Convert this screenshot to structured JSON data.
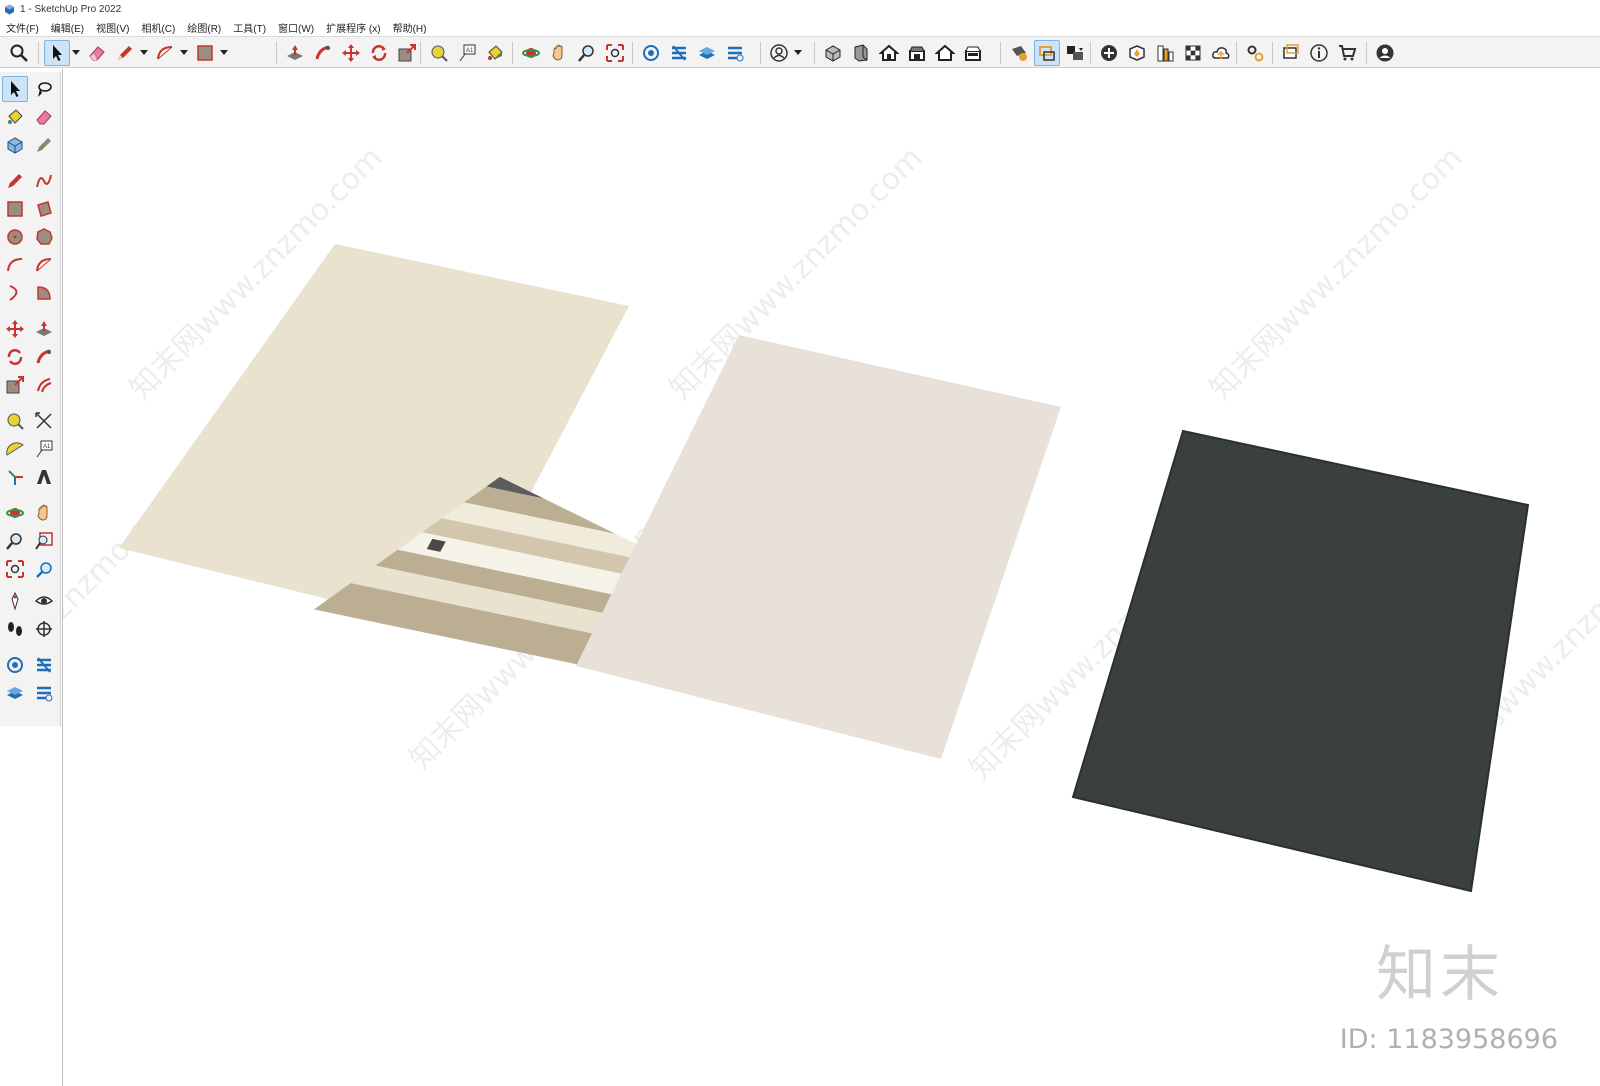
{
  "window": {
    "title": "1 - SketchUp Pro 2022"
  },
  "menu": [
    {
      "label": "文件(F)"
    },
    {
      "label": "编辑(E)"
    },
    {
      "label": "视图(V)"
    },
    {
      "label": "相机(C)"
    },
    {
      "label": "绘图(R)"
    },
    {
      "label": "工具(T)"
    },
    {
      "label": "窗口(W)"
    },
    {
      "label": "扩展程序 (x)"
    },
    {
      "label": "帮助(H)"
    }
  ],
  "top_toolbar_icons": [
    "zoom-extents-icon",
    "select-icon",
    "eraser-icon",
    "pencil-line-icon",
    "arc-icon",
    "rectangle-icon",
    "push-pull-icon",
    "follow-me-icon",
    "move-icon",
    "rotate-icon",
    "scale-icon",
    "tape-measure-icon",
    "text-label-icon",
    "paint-bucket-icon",
    "orbit-icon",
    "pan-icon",
    "zoom-icon",
    "zoom-extents-icon",
    "warehouse-icon",
    "extension-warehouse-icon",
    "layout-icon",
    "extension-manager-icon",
    "account-icon",
    "iso-view-icon",
    "top-view-icon",
    "front-view-icon",
    "right-view-icon",
    "back-view-icon",
    "left-view-icon",
    "section-plane-icon",
    "display-section-icon",
    "section-fill-icon",
    "add-location-icon",
    "terrain-icon",
    "photo-texture-icon",
    "match-photo-icon",
    "trimble-connect-icon",
    "model-info-icon",
    "message-icon",
    "info-icon",
    "cart-icon",
    "profile-icon"
  ],
  "left_toolbar_icons": [
    "select-icon",
    "lasso-icon",
    "paint-bucket-icon",
    "eraser-icon",
    "component-icon",
    "tag-icon",
    "pencil-line-icon",
    "freehand-icon",
    "rectangle-icon",
    "rotated-rectangle-icon",
    "circle-icon",
    "polygon-icon",
    "arc-icon",
    "two-point-arc-icon",
    "pie-icon",
    "three-point-arc-icon",
    "move-icon",
    "push-pull-icon",
    "rotate-icon",
    "follow-me-icon",
    "scale-icon",
    "offset-icon",
    "tape-measure-icon",
    "dimension-icon",
    "protractor-icon",
    "text-label-icon",
    "axes-icon",
    "3d-text-icon",
    "orbit-icon",
    "pan-icon",
    "zoom-icon",
    "zoom-window-icon",
    "zoom-extents-icon",
    "previous-view-icon",
    "position-camera-icon",
    "look-around-icon",
    "walk-icon",
    "section-plane-icon",
    "warehouse-icon",
    "extension-warehouse-icon",
    "layout-icon",
    "extension-manager-icon"
  ],
  "watermark": {
    "brand": "知末",
    "id_text": "ID: 1183958696",
    "site": "知末网www.znzmo.com"
  },
  "rugs": [
    {
      "name": "stripe-triangle-rug",
      "colors": [
        "#e8e2cf",
        "#bcae93",
        "#5d5d5d",
        "#f5f2e8"
      ]
    },
    {
      "name": "abstract-kilim-rug",
      "colors": [
        "#e8e1d9",
        "#c9b9a5",
        "#3f4a5a",
        "#4a79a6",
        "#a8a3a0"
      ]
    },
    {
      "name": "diamond-kilim-rug",
      "colors": [
        "#3a403f",
        "#bfb7ac",
        "#f3eee6",
        "#d88a62",
        "#a9a9a9"
      ]
    }
  ]
}
